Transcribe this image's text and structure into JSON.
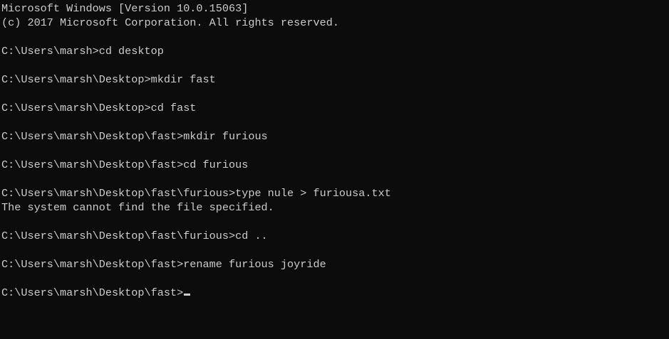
{
  "console": {
    "lines": [
      "Microsoft Windows [Version 10.0.15063]",
      "(c) 2017 Microsoft Corporation. All rights reserved.",
      "",
      "C:\\Users\\marsh>cd desktop",
      "",
      "C:\\Users\\marsh\\Desktop>mkdir fast",
      "",
      "C:\\Users\\marsh\\Desktop>cd fast",
      "",
      "C:\\Users\\marsh\\Desktop\\fast>mkdir furious",
      "",
      "C:\\Users\\marsh\\Desktop\\fast>cd furious",
      "",
      "C:\\Users\\marsh\\Desktop\\fast\\furious>type nule > furiousa.txt",
      "The system cannot find the file specified.",
      "",
      "C:\\Users\\marsh\\Desktop\\fast\\furious>cd ..",
      "",
      "C:\\Users\\marsh\\Desktop\\fast>rename furious joyride",
      "",
      "C:\\Users\\marsh\\Desktop\\fast>"
    ]
  },
  "colors": {
    "background": "#0c0c0c",
    "foreground": "#cccccc"
  }
}
